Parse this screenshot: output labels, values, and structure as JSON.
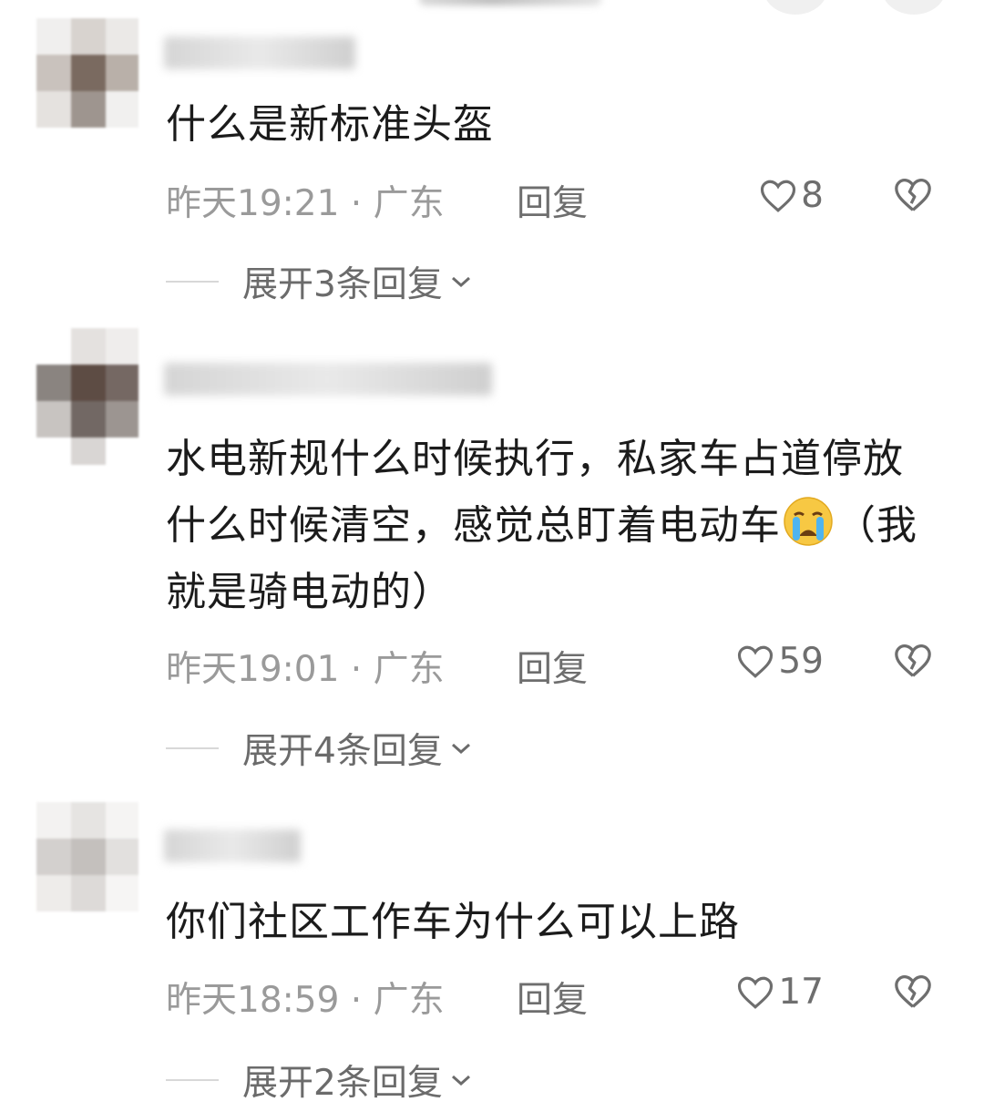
{
  "comments": [
    {
      "text": "什么是新标准头盔",
      "meta": "昨天19:21 · 广东",
      "reply_label": "回复",
      "likes": "8",
      "expand_label": "展开3条回复"
    },
    {
      "text_part1": "水电新规什么时候执行，私家车占道停放什么时候清空，感觉总盯着电动车",
      "text_part2": "（我就是骑电动的）",
      "emoji": "crying-face",
      "meta": "昨天19:01 · 广东",
      "reply_label": "回复",
      "likes": "59",
      "expand_label": "展开4条回复"
    },
    {
      "text": "你们社区工作车为什么可以上路",
      "meta": "昨天18:59 · 广东",
      "reply_label": "回复",
      "likes": "17",
      "expand_label": "展开2条回复"
    }
  ]
}
